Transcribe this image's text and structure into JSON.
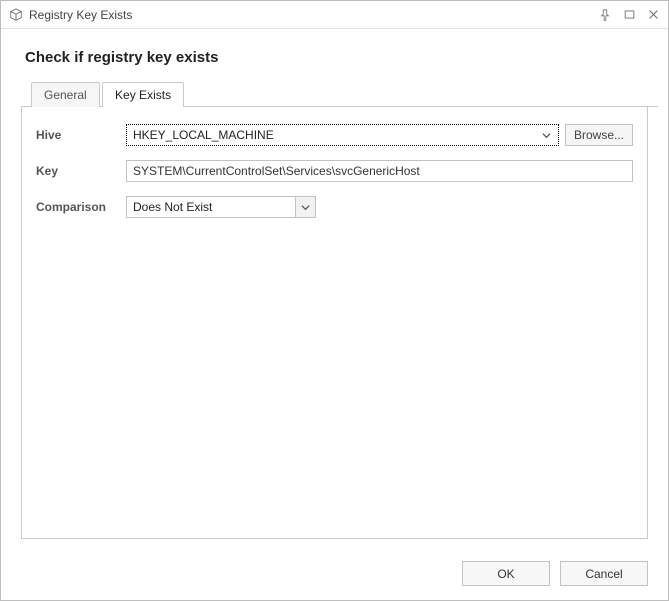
{
  "window": {
    "title": "Registry Key Exists"
  },
  "page": {
    "title": "Check if registry key exists"
  },
  "tabs": {
    "general": "General",
    "keyExists": "Key Exists"
  },
  "labels": {
    "hive": "Hive",
    "key": "Key",
    "comparison": "Comparison"
  },
  "fields": {
    "hive": "HKEY_LOCAL_MACHINE",
    "key": "SYSTEM\\CurrentControlSet\\Services\\svcGenericHost",
    "comparison": "Does Not Exist"
  },
  "buttons": {
    "browse": "Browse...",
    "ok": "OK",
    "cancel": "Cancel"
  }
}
